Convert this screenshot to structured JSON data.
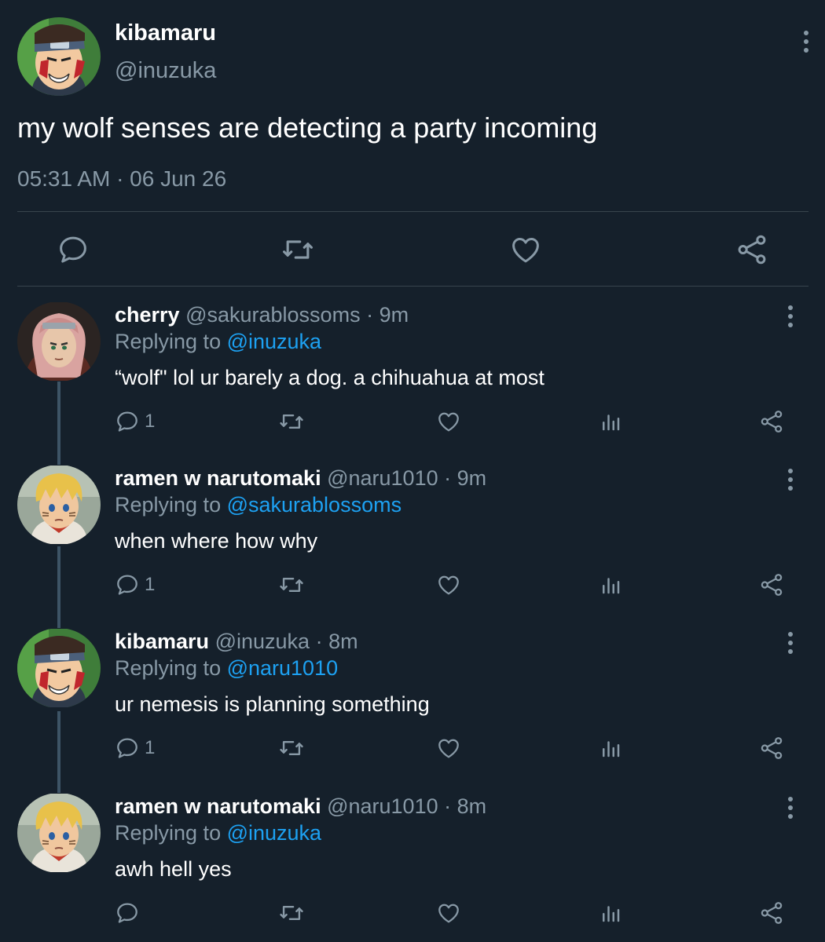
{
  "main_tweet": {
    "name": "kibamaru",
    "handle": "@inuzuka",
    "text": "my wolf senses are detecting a party incoming",
    "timestamp": "05:31 AM · 06 Jun 26",
    "icons": [
      "more-vertical-icon",
      "reply-icon",
      "retweet-icon",
      "like-icon",
      "share-icon"
    ]
  },
  "replies": [
    {
      "name": "cherry",
      "handle": "@sakurablossoms",
      "sep": " · ",
      "time": "9m",
      "replying_prefix": "Replying to ",
      "replying_to": "@inuzuka",
      "text": "“wolf\" lol ur barely a dog. a chihuahua at most",
      "reply_count": "1",
      "avatar": "pink-hair-avatar"
    },
    {
      "name": "ramen w narutomaki",
      "handle": "@naru1010",
      "sep": " · ",
      "time": "9m",
      "replying_prefix": "Replying to ",
      "replying_to": "@sakurablossoms",
      "text": "when where how why",
      "reply_count": "1",
      "avatar": "blond-hair-avatar"
    },
    {
      "name": "kibamaru",
      "handle": "@inuzuka",
      "sep": " · ",
      "time": "8m",
      "replying_prefix": "Replying to ",
      "replying_to": "@naru1010",
      "text": "ur nemesis is planning something",
      "reply_count": "1",
      "avatar": "headband-avatar"
    },
    {
      "name": "ramen w narutomaki",
      "handle": "@naru1010",
      "sep": " · ",
      "time": "8m",
      "replying_prefix": "Replying to ",
      "replying_to": "@inuzuka",
      "text": "awh hell yes",
      "reply_count": "",
      "avatar": "blond-hair-avatar"
    }
  ],
  "colors": {
    "background": "#15202b",
    "text_primary": "#ffffff",
    "text_secondary": "#8899a6",
    "link": "#1da1f2",
    "divider": "#38444d",
    "thread_line": "#3d5466"
  }
}
